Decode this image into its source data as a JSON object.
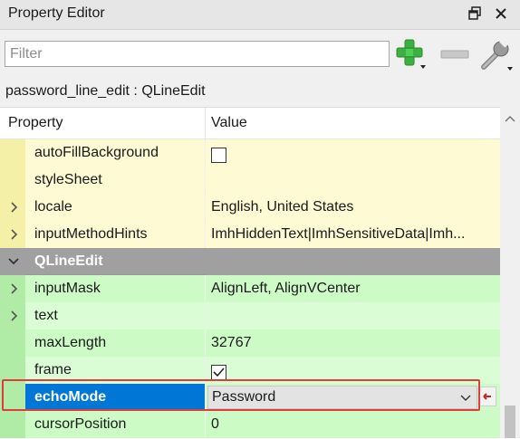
{
  "panel": {
    "title": "Property Editor",
    "filter_placeholder": "Filter",
    "object_label": "password_line_edit : QLineEdit"
  },
  "table": {
    "headers": {
      "property": "Property",
      "value": "Value"
    }
  },
  "rows": [
    {
      "name": "autoFillBackground",
      "value": "",
      "type": "checkbox",
      "checked": false,
      "expandable": false,
      "group": "yellow"
    },
    {
      "name": "styleSheet",
      "value": "",
      "type": "text",
      "expandable": false,
      "group": "yellow"
    },
    {
      "name": "locale",
      "value": "English, United States",
      "type": "text",
      "expandable": true,
      "group": "yellow"
    },
    {
      "name": "inputMethodHints",
      "value": "ImhHiddenText|ImhSensitiveData|Imh...",
      "type": "text",
      "expandable": true,
      "group": "yellow"
    },
    {
      "name": "QLineEdit",
      "value": "",
      "type": "section",
      "expandable": true,
      "group": "section"
    },
    {
      "name": "inputMask",
      "value": "AlignLeft, AlignVCenter",
      "type": "text",
      "expandable": true,
      "group": "green"
    },
    {
      "name": "text",
      "value": "",
      "type": "text",
      "expandable": true,
      "group": "green"
    },
    {
      "name": "maxLength",
      "value": "32767",
      "type": "text",
      "expandable": false,
      "group": "green"
    },
    {
      "name": "frame",
      "value": "",
      "type": "checkbox",
      "checked": true,
      "expandable": false,
      "group": "green"
    },
    {
      "name": "echoMode",
      "value": "Password",
      "type": "combo",
      "expandable": false,
      "group": "green",
      "selected": true
    },
    {
      "name": "cursorPosition",
      "value": "0",
      "type": "text",
      "expandable": false,
      "group": "green"
    }
  ],
  "colors": {
    "selection": "#0077d7",
    "highlight_border": "#e03c3c",
    "add_icon": "#3cb043"
  },
  "icons": {
    "float": "float-icon",
    "close": "close-icon",
    "add": "plus-icon",
    "remove": "minus-icon",
    "configure": "wrench-icon",
    "reset": "reset-icon"
  }
}
